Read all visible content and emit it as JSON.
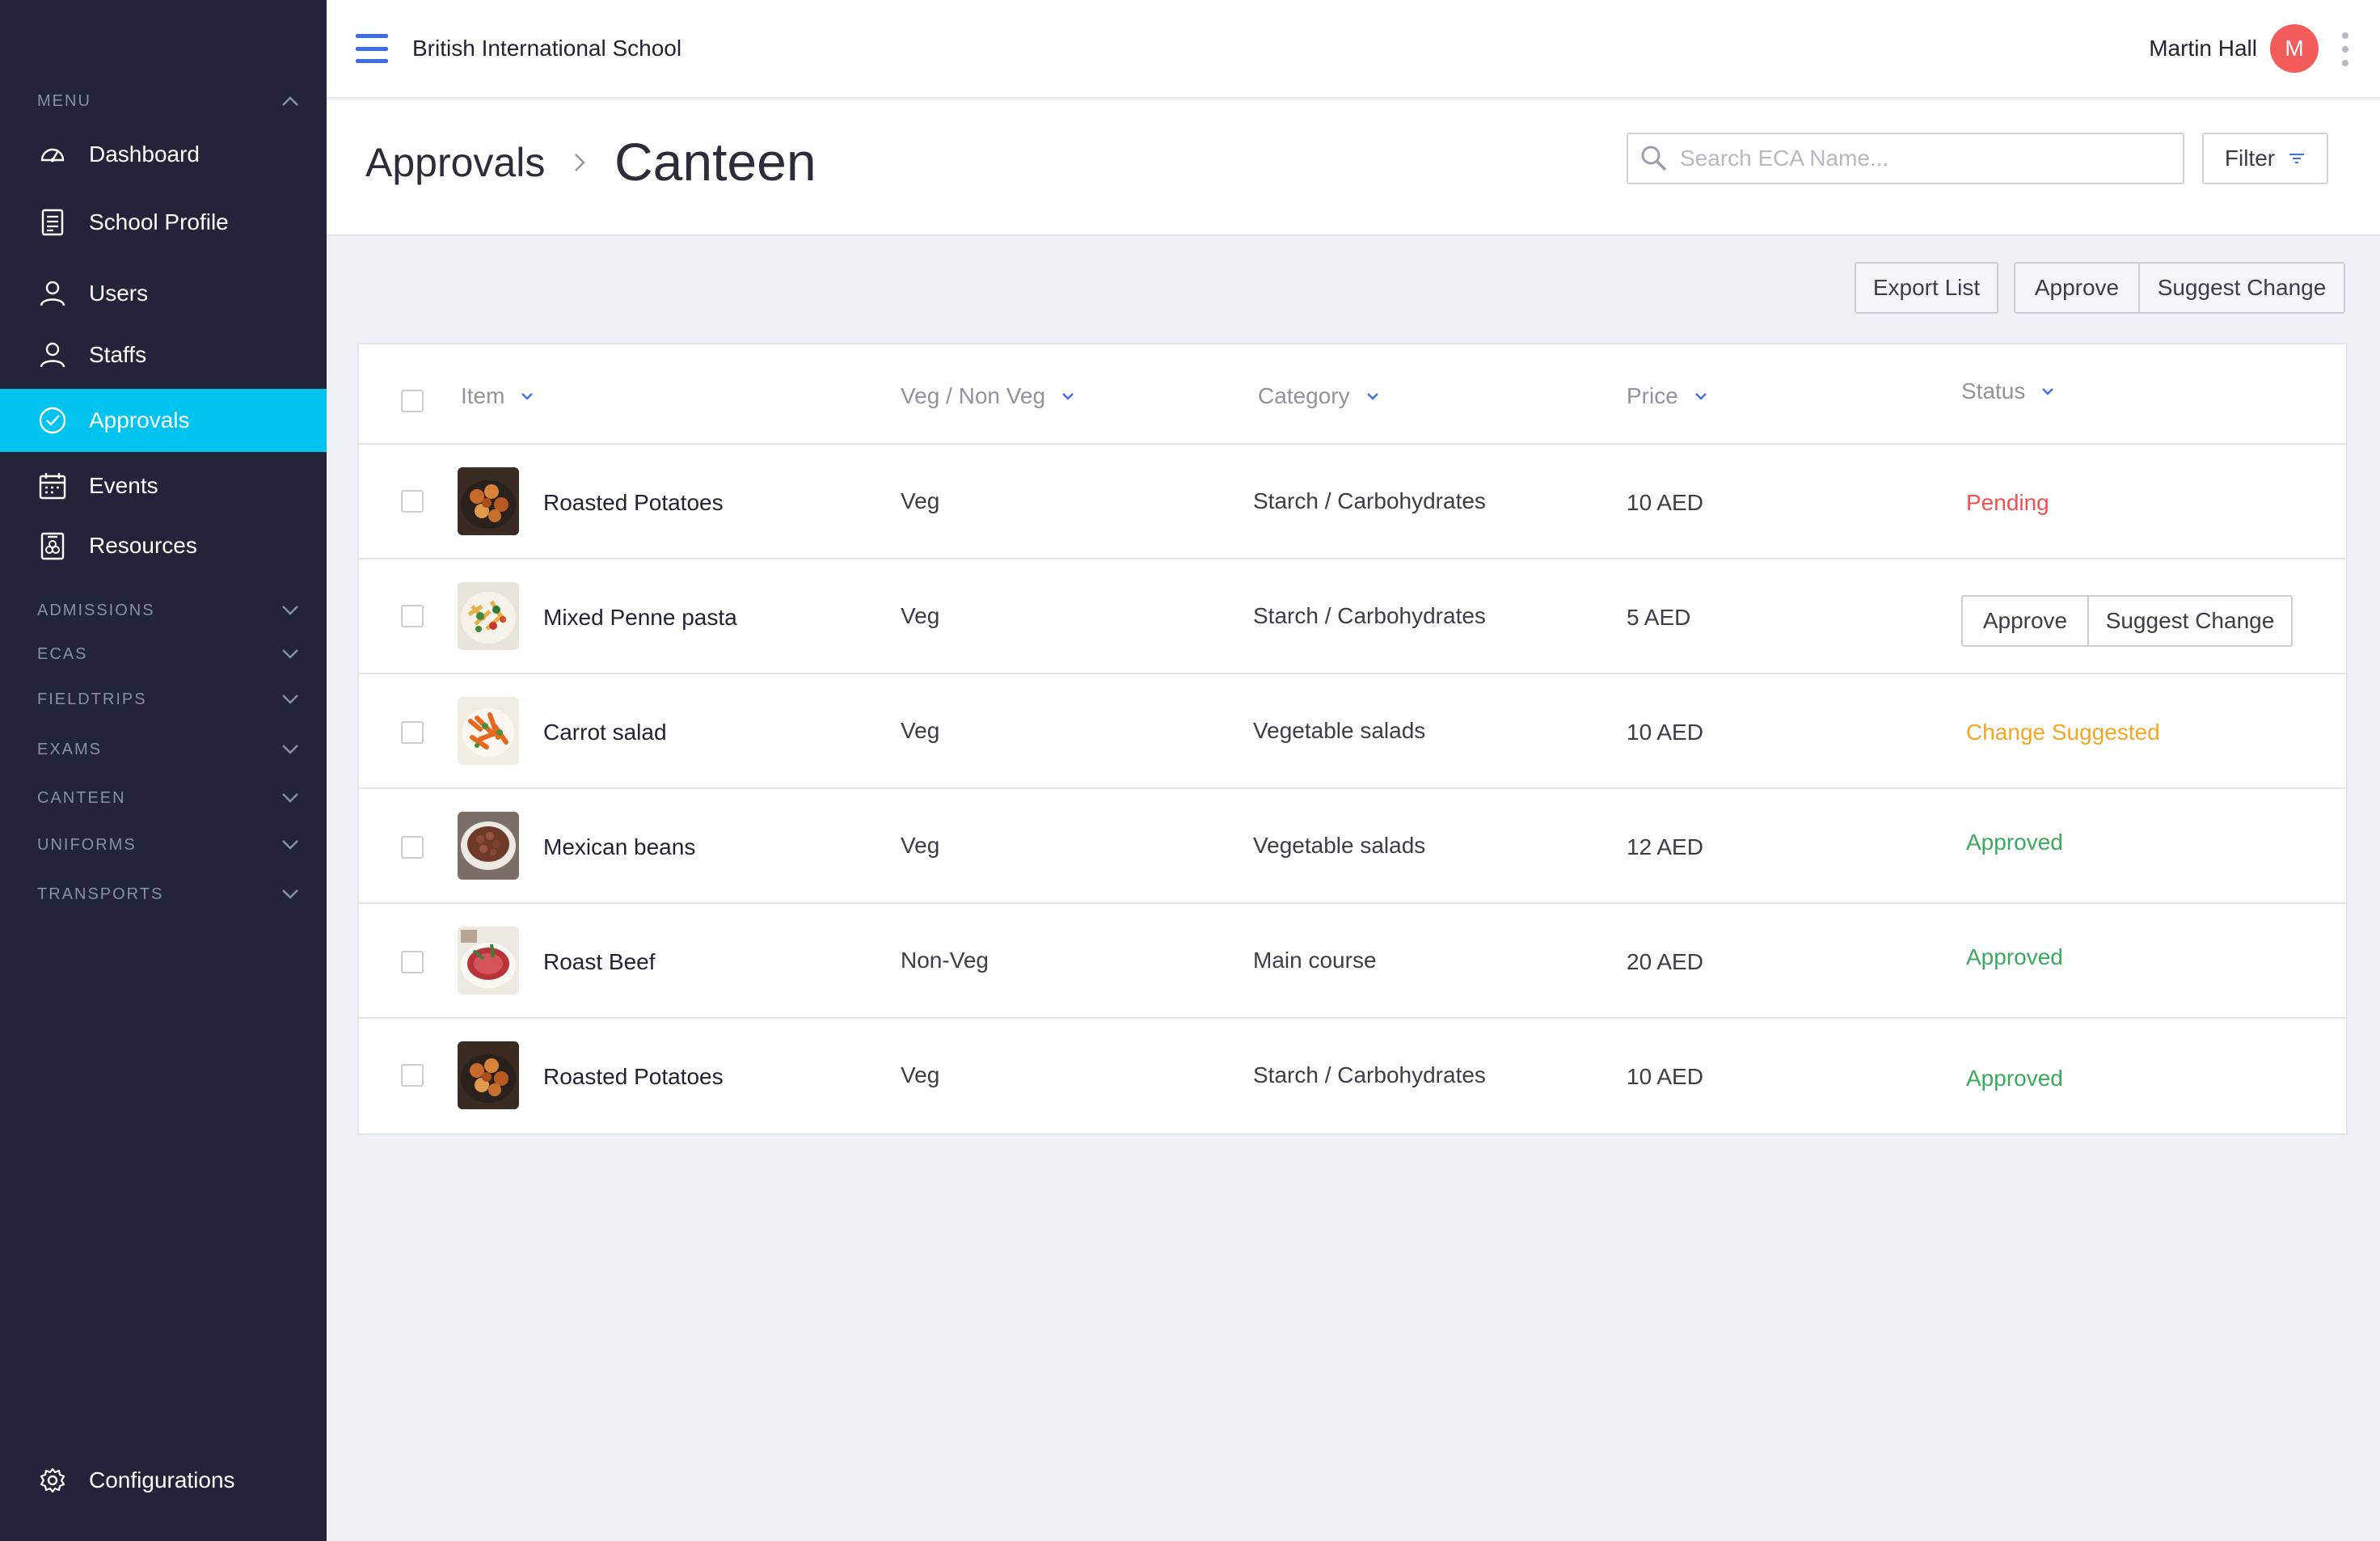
{
  "sidebar": {
    "menu_label": "MENU",
    "items": [
      {
        "label": "Dashboard",
        "icon": "dashboard-icon"
      },
      {
        "label": "School Profile",
        "icon": "document-icon"
      },
      {
        "label": "Users",
        "icon": "user-icon"
      },
      {
        "label": "Staffs",
        "icon": "user-icon"
      },
      {
        "label": "Approvals",
        "icon": "check-circle-icon",
        "active": true
      },
      {
        "label": "Events",
        "icon": "calendar-icon"
      },
      {
        "label": "Resources",
        "icon": "resources-icon"
      }
    ],
    "sections": [
      "ADMISSIONS",
      "ECAS",
      "FIELDTRIPS",
      "EXAMS",
      "CANTEEN",
      "UNIFORMS",
      "TRANSPORTS"
    ],
    "configurations": "Configurations"
  },
  "topbar": {
    "school_name": "British International School",
    "user_name": "Martin Hall",
    "avatar_initial": "M"
  },
  "header": {
    "breadcrumb_parent": "Approvals",
    "breadcrumb_current": "Canteen",
    "search_placeholder": "Search ECA Name...",
    "filter_label": "Filter"
  },
  "actions": {
    "export": "Export List",
    "approve": "Approve",
    "suggest": "Suggest Change"
  },
  "table": {
    "columns": [
      "Item",
      "Veg / Non Veg",
      "Category",
      "Price",
      "Status"
    ],
    "rows": [
      {
        "item": "Roasted Potatoes",
        "veg": "Veg",
        "category": "Starch / Carbohydrates",
        "price": "10 AED",
        "status": "Pending",
        "thumb": "potatoes"
      },
      {
        "item": "Mixed Penne pasta",
        "veg": "Veg",
        "category": "Starch / Carbohydrates",
        "price": "5 AED",
        "status": "",
        "approve_label": "Approve",
        "suggest_label": "Suggest Change",
        "thumb": "pasta"
      },
      {
        "item": "Carrot salad",
        "veg": "Veg",
        "category": "Vegetable salads",
        "price": "10 AED",
        "status": "Change Suggested",
        "thumb": "carrot"
      },
      {
        "item": "Mexican beans",
        "veg": "Veg",
        "category": "Vegetable salads",
        "price": "12 AED",
        "status": "Approved",
        "thumb": "beans"
      },
      {
        "item": "Roast Beef",
        "veg": "Non-Veg",
        "category": "Main course",
        "price": "20 AED",
        "status": "Approved",
        "thumb": "beef"
      },
      {
        "item": "Roasted Potatoes",
        "veg": "Veg",
        "category": "Starch / Carbohydrates",
        "price": "10 AED",
        "status": "Approved",
        "thumb": "potatoes"
      }
    ]
  },
  "colors": {
    "sidebar_bg": "#222539",
    "active_bg": "#00c4ee",
    "accent_blue": "#3f6fe6",
    "pending": "#f0524f",
    "change_suggested": "#f5a623",
    "approved": "#3aaa5e",
    "avatar": "#f45b5b"
  }
}
